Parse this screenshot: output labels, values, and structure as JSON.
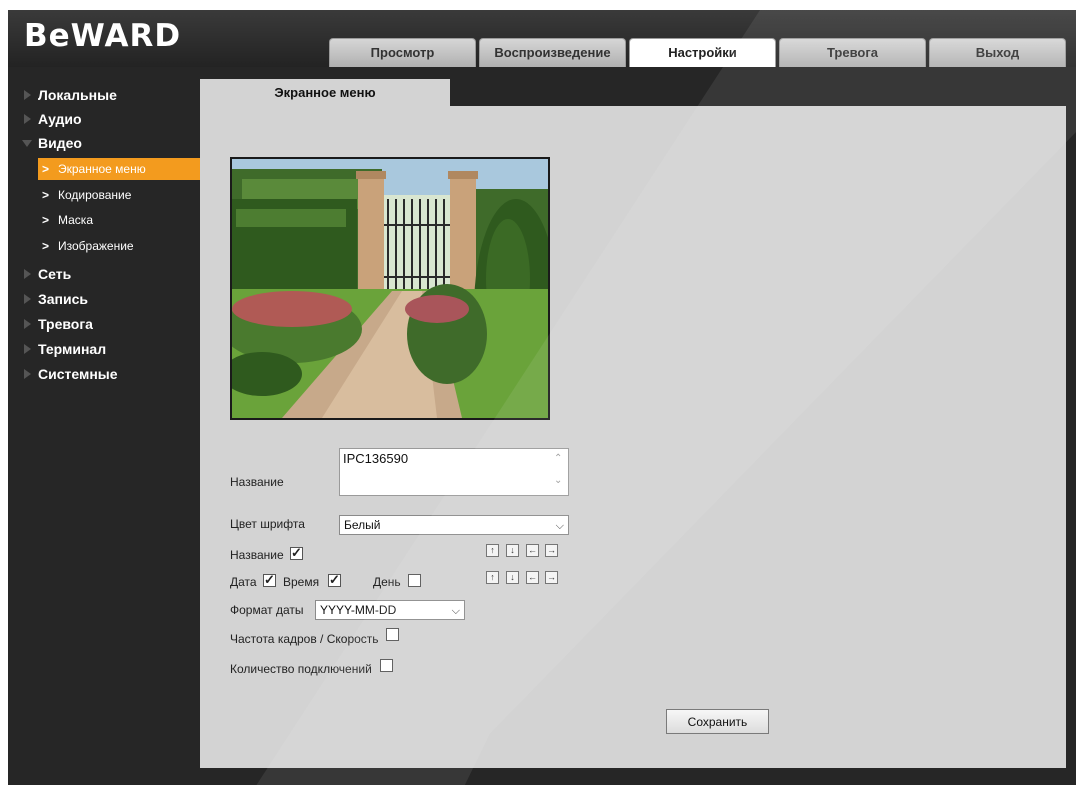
{
  "brand": {
    "logo": "BeWARD"
  },
  "header": {
    "tabs": [
      {
        "label": "Просмотр"
      },
      {
        "label": "Воспроизведение"
      },
      {
        "label": "Настройки",
        "active": true
      },
      {
        "label": "Тревога"
      },
      {
        "label": "Выход"
      }
    ]
  },
  "sidebar": {
    "items": [
      {
        "label": "Локальные"
      },
      {
        "label": "Аудио"
      },
      {
        "label": "Видео",
        "expanded": true
      },
      {
        "label": "Сеть"
      },
      {
        "label": "Запись"
      },
      {
        "label": "Тревога"
      },
      {
        "label": "Терминал"
      },
      {
        "label": "Системные"
      }
    ],
    "video_subitems": [
      {
        "label": "Экранное меню",
        "active": true
      },
      {
        "label": "Кодирование"
      },
      {
        "label": "Маска"
      },
      {
        "label": "Изображение"
      }
    ]
  },
  "main": {
    "tab_label": "Экранное меню",
    "form": {
      "name_label": "Название",
      "name_value": "IPC136590",
      "font_color_label": "Цвет шрифта",
      "font_color_value": "Белый",
      "show_name_label": "Название",
      "show_name_checked": true,
      "date_label": "Дата",
      "date_checked": true,
      "time_label": "Время",
      "time_checked": true,
      "day_label": "День",
      "day_checked": false,
      "date_format_label": "Формат даты",
      "date_format_value": "YYYY-MM-DD",
      "framerate_label": "Частота кадров / Скорость",
      "framerate_checked": false,
      "connections_label": "Количество подключений",
      "connections_checked": false,
      "save_label": "Сохранить"
    }
  },
  "colors": {
    "accent": "#f39b1e",
    "background": "#262626",
    "panel": "#d3d3d3"
  }
}
